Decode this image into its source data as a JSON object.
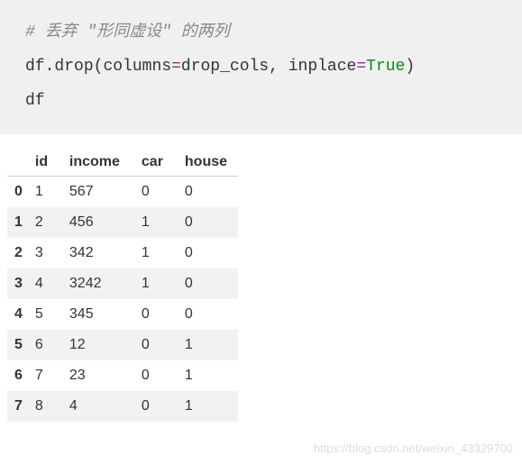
{
  "code": {
    "comment": "# 丢弃 \"形同虚设\" 的两列",
    "line2": {
      "df": "df",
      "dot": ".",
      "drop": "drop",
      "lparen": "(",
      "columns": "columns",
      "equals": "=",
      "dropcols": "drop_cols",
      "comma": ", ",
      "inplace": "inplace",
      "equals2": "=",
      "true": "True",
      "rparen": ")"
    },
    "line3": "df"
  },
  "chart_data": {
    "type": "table",
    "columns": [
      "id",
      "income",
      "car",
      "house"
    ],
    "index": [
      "0",
      "1",
      "2",
      "3",
      "4",
      "5",
      "6",
      "7"
    ],
    "rows": [
      {
        "id": "1",
        "income": "567",
        "car": "0",
        "house": "0"
      },
      {
        "id": "2",
        "income": "456",
        "car": "1",
        "house": "0"
      },
      {
        "id": "3",
        "income": "342",
        "car": "1",
        "house": "0"
      },
      {
        "id": "4",
        "income": "3242",
        "car": "1",
        "house": "0"
      },
      {
        "id": "5",
        "income": "345",
        "car": "0",
        "house": "0"
      },
      {
        "id": "6",
        "income": "12",
        "car": "0",
        "house": "1"
      },
      {
        "id": "7",
        "income": "23",
        "car": "0",
        "house": "1"
      },
      {
        "id": "8",
        "income": "4",
        "car": "0",
        "house": "1"
      }
    ]
  },
  "watermark": "https://blog.csdn.net/weixin_43329700"
}
